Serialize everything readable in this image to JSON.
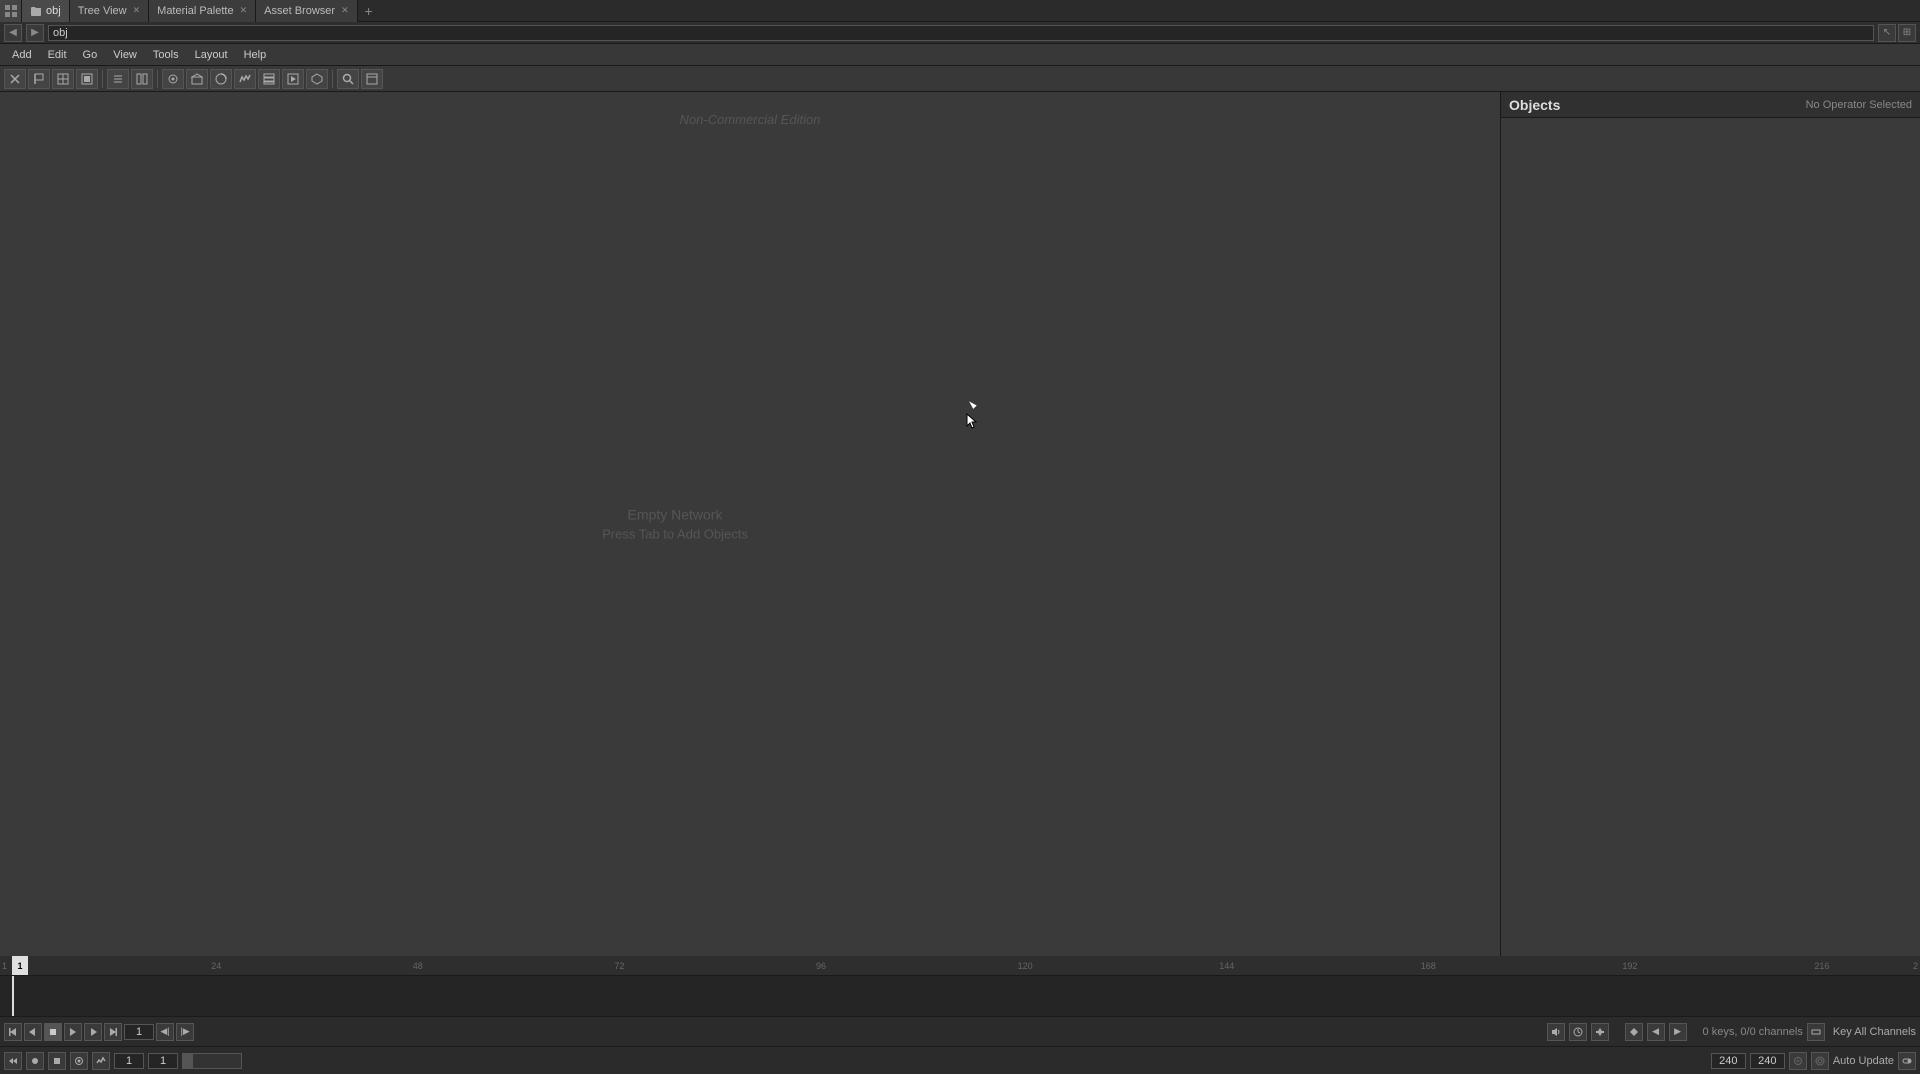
{
  "tabs": [
    {
      "id": "obj",
      "label": "obj",
      "active": true
    },
    {
      "id": "tree-view",
      "label": "Tree View",
      "active": false,
      "closable": true
    },
    {
      "id": "material-palette",
      "label": "Material Palette",
      "active": false,
      "closable": true
    },
    {
      "id": "asset-browser",
      "label": "Asset Browser",
      "active": false,
      "closable": true
    }
  ],
  "path_bar": {
    "back_label": "◀",
    "forward_label": "▶",
    "path_value": "obj",
    "right_buttons": [
      "↖",
      "⊞"
    ]
  },
  "menu": {
    "items": [
      "Add",
      "Edit",
      "Go",
      "View",
      "Tools",
      "Layout",
      "Help"
    ]
  },
  "toolbar": {
    "tools": [
      "✕",
      "⊟",
      "⊞",
      "⊡",
      "⊟",
      "☰",
      "☰",
      "⊡",
      "⊡",
      "⊡",
      "⊡",
      "⊡",
      "⊡",
      "🔍",
      "⊡"
    ]
  },
  "network_viewport": {
    "watermark": "Non-Commercial Edition",
    "empty_line1": "Empty Network",
    "empty_line2": "Press Tab to Add Objects"
  },
  "objects_panel": {
    "title": "Objects",
    "no_operator_label": "No Operator Selected"
  },
  "timeline": {
    "ticks": [
      {
        "value": "1",
        "pos": 0
      },
      {
        "value": "24",
        "pos": 7.5
      },
      {
        "value": "48",
        "pos": 15
      },
      {
        "value": "72",
        "pos": 22.5
      },
      {
        "value": "96",
        "pos": 30
      },
      {
        "value": "120",
        "pos": 37.5
      },
      {
        "value": "144",
        "pos": 45
      },
      {
        "value": "168",
        "pos": 52.5
      },
      {
        "value": "192",
        "pos": 60
      },
      {
        "value": "216",
        "pos": 67.5
      },
      {
        "value": "2",
        "pos": 100
      }
    ]
  },
  "transport": {
    "skip_start_label": "⏮",
    "prev_frame_label": "◀",
    "stop_label": "■",
    "play_label": "▶",
    "next_frame_label": "▶",
    "skip_end_label": "⏭",
    "frame_value": "1",
    "step_back_label": "◀|",
    "step_fwd_label": "|▶"
  },
  "bottom_transport": {
    "audio_label": "🔊",
    "loop_label": "↺",
    "realtime_label": "⏱",
    "keys_info": "0 keys, 0/0 channels",
    "key_all_channels_label": "Key All Channels"
  },
  "bottom_controls": {
    "rewind_btn": "⏮",
    "record_btn": "⏺",
    "stop_btn": "■",
    "buttons": [
      "⊡",
      "⊡",
      "⊡",
      "⊡",
      "⊡"
    ],
    "start_frame": "1",
    "end_frame": "1",
    "range_start": "240",
    "range_end": "240",
    "auto_update_label": "Auto Update"
  }
}
